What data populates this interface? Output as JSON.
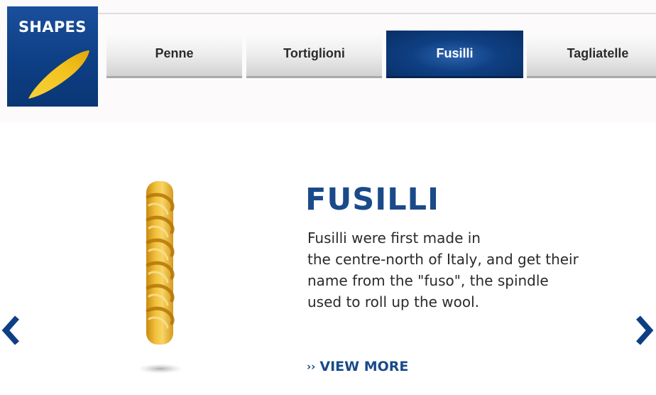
{
  "logo": {
    "title": "SHAPES"
  },
  "tabs": [
    {
      "label": "Penne",
      "active": false
    },
    {
      "label": "Tortiglioni",
      "active": false
    },
    {
      "label": "Fusilli",
      "active": true
    },
    {
      "label": "Tagliatelle",
      "active": false
    }
  ],
  "product": {
    "heading": "FUSILLI",
    "description_lines": [
      "Fusilli were first made in",
      "the centre-north of Italy, and get their",
      "name from the \"fuso\", the spindle",
      "used to roll up the wool."
    ],
    "view_more": {
      "chevron": "››",
      "label": "VIEW MORE"
    }
  },
  "nav": {
    "prev_icon": "chevron-left-icon",
    "next_icon": "chevron-right-icon"
  },
  "colors": {
    "brand_blue": "#0e3f85",
    "heading_blue": "#1a4a8a",
    "pasta_yellow": "#f0c430"
  }
}
